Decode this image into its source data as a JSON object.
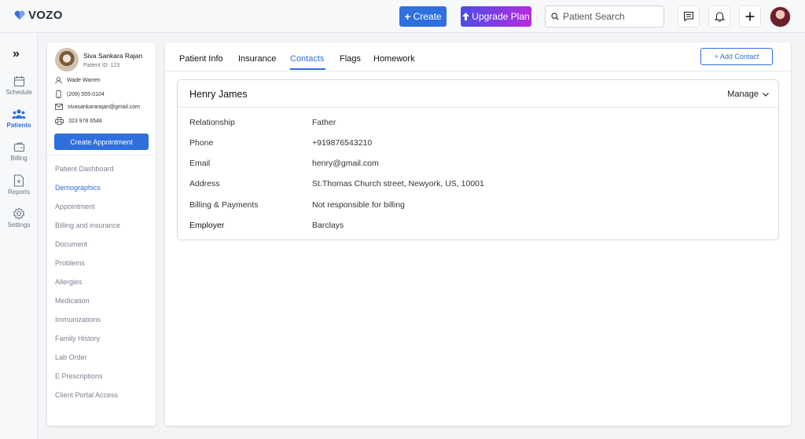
{
  "brand": {
    "name": "VOZO"
  },
  "topbar": {
    "create_label": "Create",
    "upgrade_label": "Upgrade Plan",
    "search_placeholder": "Patient Search"
  },
  "leftnav": {
    "items": [
      {
        "label": "Schedule",
        "icon": "calendar-icon"
      },
      {
        "label": "Patients",
        "icon": "users-icon"
      },
      {
        "label": "Billing",
        "icon": "wallet-icon"
      },
      {
        "label": "Reports",
        "icon": "report-icon"
      },
      {
        "label": "Settings",
        "icon": "gear-icon"
      }
    ],
    "active": "Patients"
  },
  "patient": {
    "name": "Siva Sankara Rajan",
    "id_text": "Patient ID: 123",
    "contact_person": "Wade Warren",
    "phone": "(209) 555-0104",
    "email": "sivasankararajan@gmail.com",
    "fax": "323 978 6548",
    "appointment_button": "Create Appointment"
  },
  "patient_menu": [
    "Patient Dashboard",
    "Demographics",
    "Appointment",
    "Billing and insurance",
    "Document",
    "Problems",
    "Allergies",
    "Medication",
    "Immunizations",
    "Family History",
    "Lab Order",
    "E Prescriptions",
    "Client Portal Access"
  ],
  "tabs": [
    "Patient Info",
    "Insurance",
    "Contacts",
    "Flags",
    "Homework"
  ],
  "active_tab": "Contacts",
  "add_contact_label": "+ Add Contact",
  "contact_card": {
    "name": "Henry James",
    "manage_label": "Manage",
    "fields": [
      {
        "label": "Relationship",
        "value": "Father"
      },
      {
        "label": "Phone",
        "value": "+919876543210"
      },
      {
        "label": "Email",
        "value": "henry@gmail.com"
      },
      {
        "label": "Address",
        "value": "St.Thomas Church street, Newyork, US, 10001"
      },
      {
        "label": "Billing & Payments",
        "value": "Not responsible for billing"
      },
      {
        "label": "Employer",
        "value": "Barclays"
      }
    ]
  },
  "colors": {
    "primary": "#2f6fde",
    "upgrade_start": "#4a4de6",
    "upgrade_end": "#b62be0"
  }
}
